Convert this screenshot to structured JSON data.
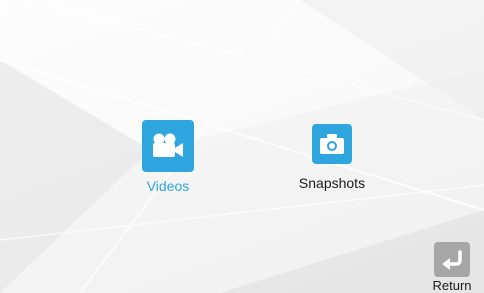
{
  "menu": {
    "items": [
      {
        "label": "Videos",
        "icon": "video-camera-icon",
        "selected": true
      },
      {
        "label": "Snapshots",
        "icon": "camera-icon",
        "selected": false
      }
    ]
  },
  "footer": {
    "return_label": "Return",
    "return_icon": "return-arrow-icon"
  },
  "colors": {
    "accent": "#2fa5de",
    "return_tile": "#a6a6a6",
    "text": "#1a1a1a"
  }
}
